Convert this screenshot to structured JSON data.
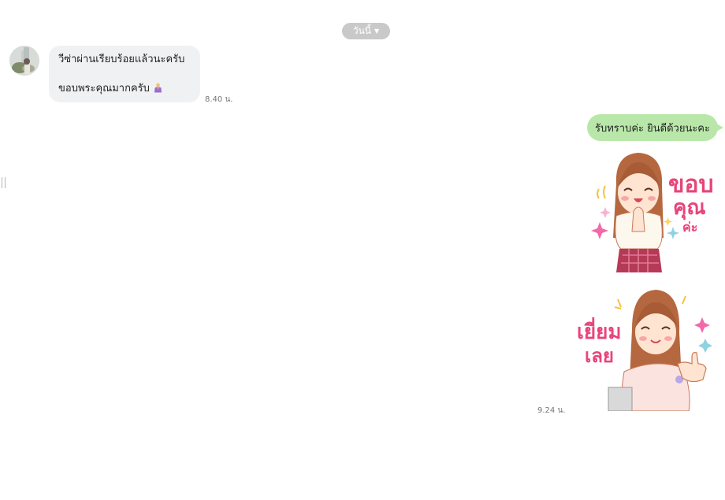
{
  "chat": {
    "date_label": "วันนี้",
    "incoming": {
      "line1": "วีซ่าผ่านเรียบร้อยแล้วนะครับ",
      "line2": "ขอบพระคุณมากครับ",
      "emoji": "folded-hands-person-emoji",
      "time": "8.40 น."
    },
    "outgoing": {
      "text": "รับทราบค่ะ ยินดีด้วยนะคะ",
      "time": "9.24 น."
    },
    "stickers": [
      {
        "icon": "thank-you-girl-sticker",
        "text": [
          "ขอบ",
          "คุณ",
          "ค่ะ"
        ]
      },
      {
        "icon": "excellent-thumbs-up-girl-sticker",
        "text": [
          "เยี่ยม",
          "เลย"
        ]
      }
    ]
  },
  "colors": {
    "outgoing_bubble": "#b9e7a9",
    "incoming_bubble": "#f0f1f3",
    "date_pill": "#c9c9c9",
    "sticker_text_pink": "#e8447a"
  }
}
